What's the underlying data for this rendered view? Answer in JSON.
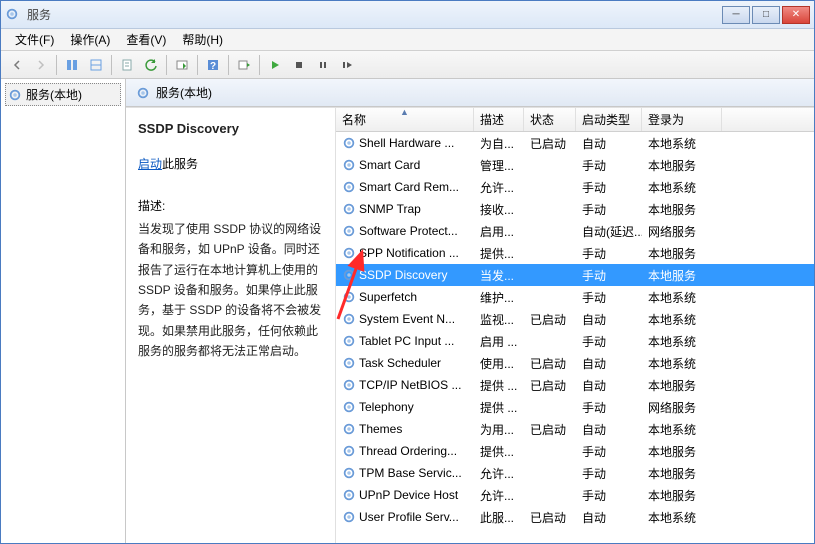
{
  "window": {
    "title": "服务"
  },
  "menu": {
    "file": "文件(F)",
    "action": "操作(A)",
    "view": "查看(V)",
    "help": "帮助(H)"
  },
  "left": {
    "node": "服务(本地)"
  },
  "rp_header": {
    "title": "服务(本地)"
  },
  "detail": {
    "svcname": "SSDP Discovery",
    "start_link": "启动",
    "start_suffix": "此服务",
    "desc_label": "描述:",
    "desc_text": "当发现了使用 SSDP 协议的网络设备和服务，如 UPnP 设备。同时还报告了运行在本地计算机上使用的 SSDP 设备和服务。如果停止此服务，基于 SSDP 的设备将不会被发现。如果禁用此服务，任何依赖此服务的服务都将无法正常启动。"
  },
  "columns": {
    "name": "名称",
    "desc": "描述",
    "status": "状态",
    "startup": "启动类型",
    "logon": "登录为"
  },
  "rows": [
    {
      "name": "Shell Hardware ...",
      "desc": "为自...",
      "status": "已启动",
      "startup": "自动",
      "logon": "本地系统"
    },
    {
      "name": "Smart Card",
      "desc": "管理...",
      "status": "",
      "startup": "手动",
      "logon": "本地服务"
    },
    {
      "name": "Smart Card Rem...",
      "desc": "允许...",
      "status": "",
      "startup": "手动",
      "logon": "本地系统"
    },
    {
      "name": "SNMP Trap",
      "desc": "接收...",
      "status": "",
      "startup": "手动",
      "logon": "本地服务"
    },
    {
      "name": "Software Protect...",
      "desc": "启用...",
      "status": "",
      "startup": "自动(延迟...",
      "logon": "网络服务"
    },
    {
      "name": "SPP Notification ...",
      "desc": "提供...",
      "status": "",
      "startup": "手动",
      "logon": "本地服务"
    },
    {
      "name": "SSDP Discovery",
      "desc": "当发...",
      "status": "",
      "startup": "手动",
      "logon": "本地服务",
      "selected": true
    },
    {
      "name": "Superfetch",
      "desc": "维护...",
      "status": "",
      "startup": "手动",
      "logon": "本地系统"
    },
    {
      "name": "System Event N...",
      "desc": "监视...",
      "status": "已启动",
      "startup": "自动",
      "logon": "本地系统"
    },
    {
      "name": "Tablet PC Input ...",
      "desc": "启用 ...",
      "status": "",
      "startup": "手动",
      "logon": "本地系统"
    },
    {
      "name": "Task Scheduler",
      "desc": "使用...",
      "status": "已启动",
      "startup": "自动",
      "logon": "本地系统"
    },
    {
      "name": "TCP/IP NetBIOS ...",
      "desc": "提供 ...",
      "status": "已启动",
      "startup": "自动",
      "logon": "本地服务"
    },
    {
      "name": "Telephony",
      "desc": "提供 ...",
      "status": "",
      "startup": "手动",
      "logon": "网络服务"
    },
    {
      "name": "Themes",
      "desc": "为用...",
      "status": "已启动",
      "startup": "自动",
      "logon": "本地系统"
    },
    {
      "name": "Thread Ordering...",
      "desc": "提供...",
      "status": "",
      "startup": "手动",
      "logon": "本地服务"
    },
    {
      "name": "TPM Base Servic...",
      "desc": "允许...",
      "status": "",
      "startup": "手动",
      "logon": "本地服务"
    },
    {
      "name": "UPnP Device Host",
      "desc": "允许...",
      "status": "",
      "startup": "手动",
      "logon": "本地服务"
    },
    {
      "name": "User Profile Serv...",
      "desc": "此服...",
      "status": "已启动",
      "startup": "自动",
      "logon": "本地系统"
    }
  ]
}
